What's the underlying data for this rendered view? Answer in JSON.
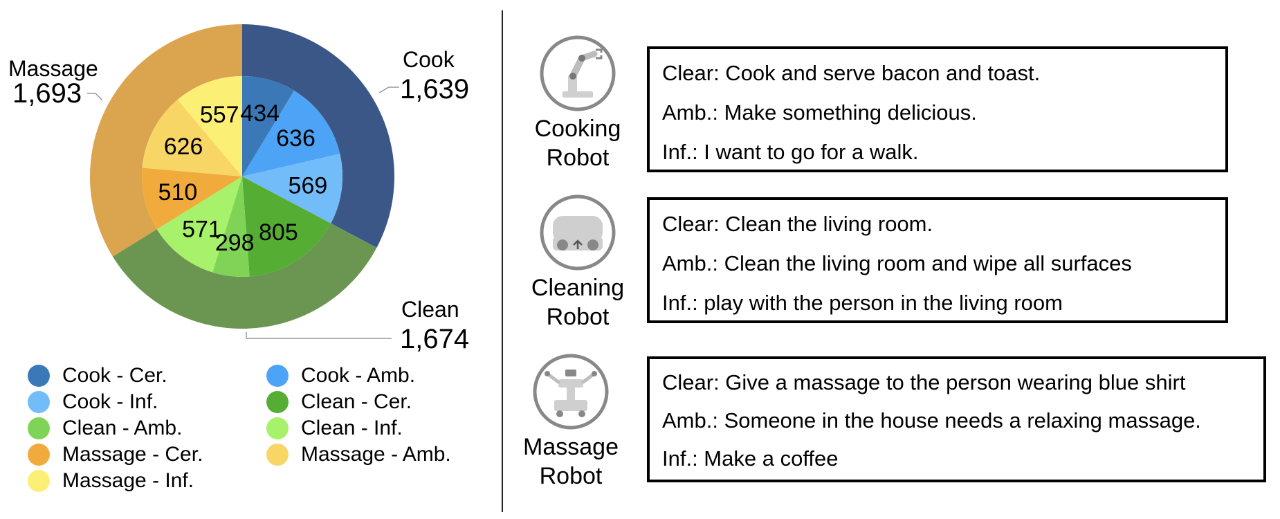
{
  "chart_data": {
    "type": "pie",
    "subtype": "nested-donut",
    "title": "",
    "outer_ring": [
      {
        "label": "Cook",
        "display": "1,639",
        "value": 1639,
        "color": "#3a5787"
      },
      {
        "label": "Clean",
        "display": "1,674",
        "value": 1674,
        "color": "#6b9652"
      },
      {
        "label": "Massage",
        "display": "1,693",
        "value": 1693,
        "color": "#dba550"
      }
    ],
    "inner_ring": [
      {
        "label": "Cook - Cer.",
        "value": 434,
        "color": "#3a78b8"
      },
      {
        "label": "Cook - Amb.",
        "value": 636,
        "color": "#4da3f5"
      },
      {
        "label": "Cook - Inf.",
        "value": 569,
        "color": "#72bcf9"
      },
      {
        "label": "Clean - Cer.",
        "value": 805,
        "color": "#55ad34"
      },
      {
        "label": "Clean - Amb.",
        "value": 298,
        "color": "#7fd457"
      },
      {
        "label": "Clean - Inf.",
        "value": 571,
        "color": "#a7f26a"
      },
      {
        "label": "Massage - Cer.",
        "value": 510,
        "color": "#f1ab3c"
      },
      {
        "label": "Massage - Amb.",
        "value": 626,
        "color": "#f8d666"
      },
      {
        "label": "Massage - Inf.",
        "value": 557,
        "color": "#fcef76"
      }
    ],
    "legend": [
      {
        "label": "Cook - Cer.",
        "color": "#3a78b8"
      },
      {
        "label": "Cook - Amb.",
        "color": "#4da3f5"
      },
      {
        "label": "Cook - Inf.",
        "color": "#72bcf9"
      },
      {
        "label": "Clean - Cer.",
        "color": "#55ad34"
      },
      {
        "label": "Clean - Amb.",
        "color": "#7fd457"
      },
      {
        "label": "Clean - Inf.",
        "color": "#a7f26a"
      },
      {
        "label": "Massage - Cer.",
        "color": "#f1ab3c"
      },
      {
        "label": "Massage - Amb.",
        "color": "#f8d666"
      },
      {
        "label": "Massage - Inf.",
        "color": "#fcef76"
      }
    ],
    "legend_placement": "bottom",
    "grid": false
  },
  "robots": [
    {
      "id": "cooking",
      "name_line1": "Cooking",
      "name_line2": "Robot",
      "icon": "robot-arm-icon",
      "lines": [
        "Clear: Cook and serve bacon and toast.",
        "Amb.: Make something delicious.",
        "Inf.: I want to go for a walk."
      ]
    },
    {
      "id": "cleaning",
      "name_line1": "Cleaning",
      "name_line2": "Robot",
      "icon": "vacuum-robot-icon",
      "lines": [
        "Clear: Clean the living room.",
        "Amb.: Clean the living room and wipe all surfaces",
        "Inf.: play with the person in the living room"
      ]
    },
    {
      "id": "massage",
      "name_line1": "Massage",
      "name_line2": "Robot",
      "icon": "massage-robot-icon",
      "lines": [
        "Clear: Give a massage to the person wearing blue shirt",
        "Amb.: Someone in the house needs a relaxing massage.",
        "Inf.: Make a coffee"
      ]
    }
  ],
  "colors": {
    "icon_gray": "#888888",
    "icon_light": "#cfcfcf",
    "border": "#000000"
  }
}
